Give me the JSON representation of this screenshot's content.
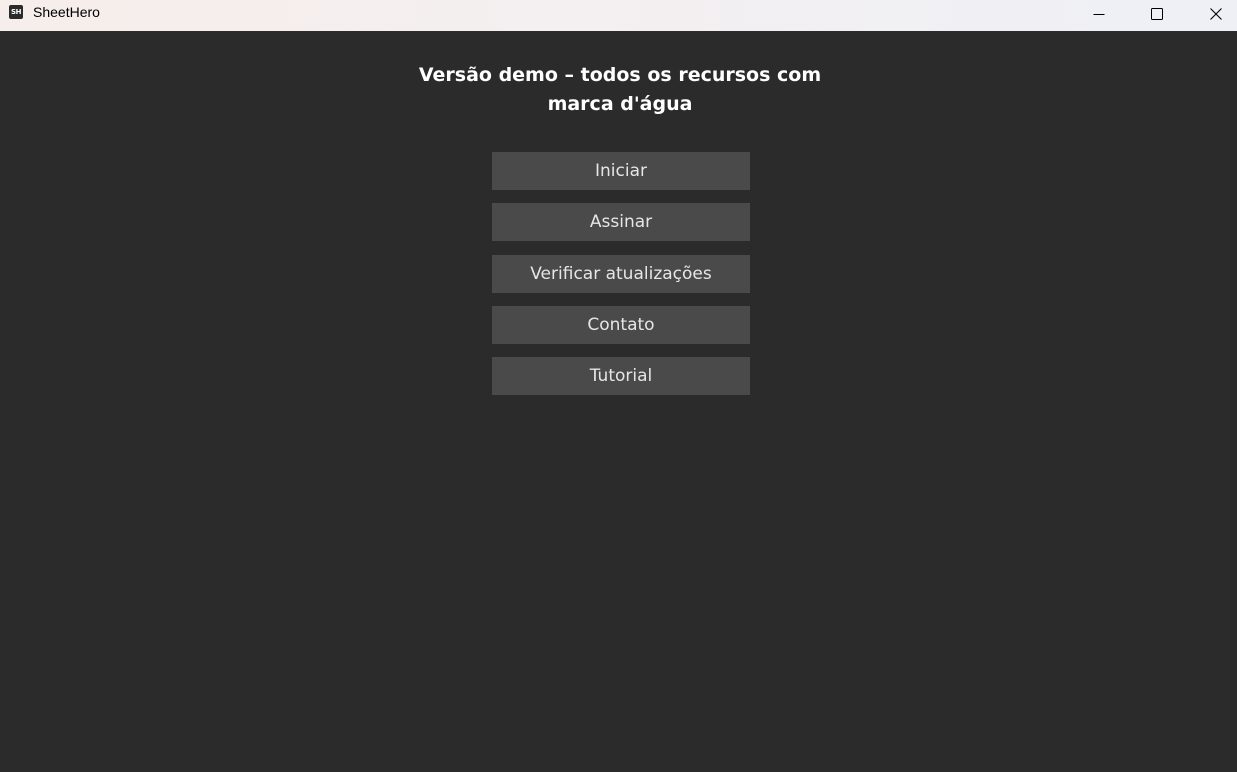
{
  "window": {
    "title": "SheetHero",
    "icon_label": "SH",
    "icon": "sheethero-app-icon",
    "controls": {
      "minimize": "minimize-icon",
      "maximize": "maximize-icon",
      "close": "close-icon"
    }
  },
  "main": {
    "heading": "Versão demo – todos os recursos com marca d'água",
    "buttons": [
      {
        "label": "Iniciar"
      },
      {
        "label": "Assinar"
      },
      {
        "label": "Verificar atualizações"
      },
      {
        "label": "Contato"
      },
      {
        "label": "Tutorial"
      }
    ]
  },
  "colors": {
    "background": "#2b2b2b",
    "button_bg": "#4a4a4a",
    "button_text": "#e6e6e6",
    "heading_text": "#ffffff"
  }
}
